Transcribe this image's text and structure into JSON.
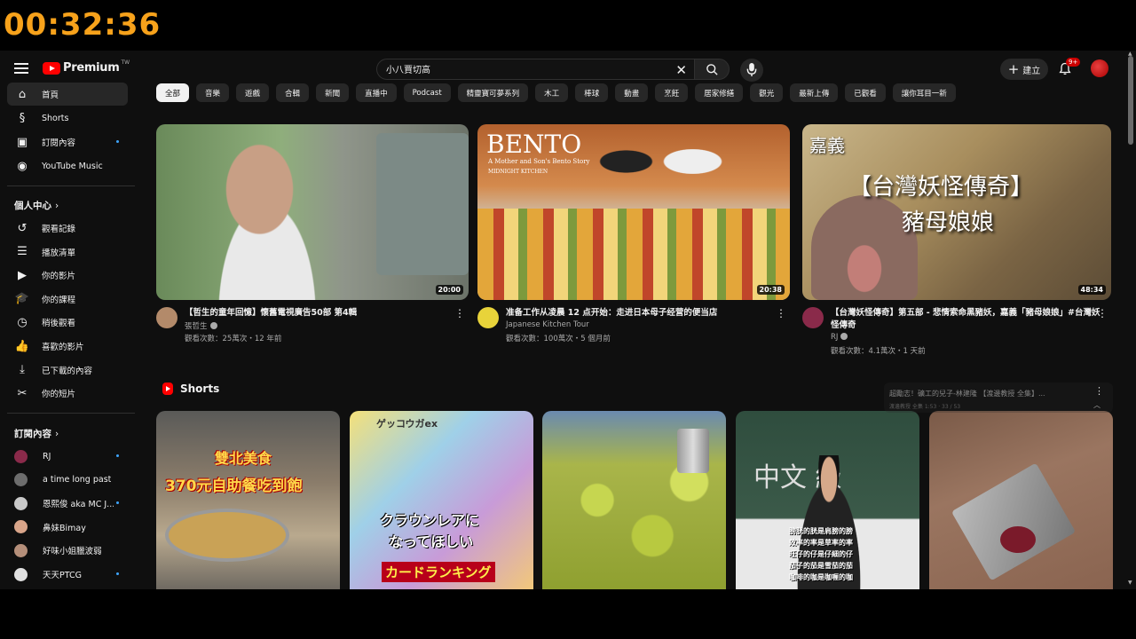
{
  "timer": "00:32:36",
  "header": {
    "brand": "Premium",
    "brand_sup": "TW",
    "search_value": "小八賈切高",
    "create_label": "建立",
    "notification_count": "9+"
  },
  "sidebar": {
    "main": [
      {
        "label": "首頁",
        "icon": "home-icon"
      },
      {
        "label": "Shorts",
        "icon": "shorts-icon"
      },
      {
        "label": "訂閱內容",
        "icon": "subscriptions-icon"
      },
      {
        "label": "YouTube Music",
        "icon": "youtube-music-icon"
      }
    ],
    "you_heading": "個人中心",
    "you": [
      {
        "label": "觀看記錄",
        "icon": "history-icon"
      },
      {
        "label": "播放清單",
        "icon": "playlists-icon"
      },
      {
        "label": "你的影片",
        "icon": "your-videos-icon"
      },
      {
        "label": "你的課程",
        "icon": "courses-icon"
      },
      {
        "label": "稍後觀看",
        "icon": "watch-later-icon"
      },
      {
        "label": "喜歡的影片",
        "icon": "liked-videos-icon"
      },
      {
        "label": "已下載的內容",
        "icon": "downloads-icon"
      },
      {
        "label": "你的短片",
        "icon": "your-clips-icon"
      }
    ],
    "subs_heading": "訂閱內容",
    "subs": [
      {
        "label": "RJ",
        "color": "#8a2a4a"
      },
      {
        "label": "a time long past",
        "color": "#6d6d6d"
      },
      {
        "label": "恩熙俊 aka MC J...",
        "color": "#c9c9c9"
      },
      {
        "label": "鼻妹Bimay",
        "color": "#d9a58a"
      },
      {
        "label": "好味小姐臘波弱",
        "color": "#b58f7a"
      },
      {
        "label": "天天PTCG",
        "color": "#e0e0e0"
      }
    ]
  },
  "chips": [
    "全部",
    "音樂",
    "遊戲",
    "合輯",
    "新聞",
    "直播中",
    "Podcast",
    "精靈寶可夢系列",
    "木工",
    "棒球",
    "動畫",
    "烹飪",
    "居家修繕",
    "觀光",
    "最新上傳",
    "已觀看",
    "讓你耳目一新"
  ],
  "videos": [
    {
      "title": "【哲生的童年回憶】懷舊電視廣告50部 第4輯",
      "channel": "張哲生",
      "stats": "觀看次數：25萬次・12 年前",
      "duration": "20:00",
      "verified": true
    },
    {
      "title": "准备工作从凌晨 12 点开始：走进日本母子经营的便当店",
      "channel": "Japanese Kitchen Tour",
      "stats": "觀看次數：100萬次・5 個月前",
      "duration": "20:38",
      "verified": false,
      "thumb_title": "BENTO",
      "thumb_sub1": "A Mother and Son's Bento Story",
      "thumb_sub2": "MIDNIGHT KITCHEN"
    },
    {
      "title": "【台灣妖怪傳奇】第五部 - 悲情索命黑豬妖，嘉義「豬母娘娘」#台灣妖怪傳奇",
      "channel": "RJ",
      "stats": "觀看次數：4.1萬次・1 天前",
      "duration": "48:34",
      "verified": true,
      "thumb_place": "嘉義",
      "thumb_title": "【台灣妖怪傳奇】",
      "thumb_sub": "豬母娘娘"
    }
  ],
  "shorts": {
    "heading": "Shorts",
    "items": [
      {
        "cap1": "雙北美食",
        "cap2": "370元自助餐吃到飽"
      },
      {
        "cap1": "クラウンレアに",
        "cap2": "なってほしい",
        "cap3": "カードランキング",
        "cap4": "ゲッコウガex"
      },
      {},
      {
        "board": "中文 級",
        "sub1": "膀胱的胱是肩膀的膀",
        "sub2": "效率的率是草率的率",
        "sub3": "旺仔的仔是仔細的仔",
        "sub4": "茄子的茄是雪茄的茄",
        "sub5": "咖啡的咖是咖喱的咖"
      },
      {}
    ]
  },
  "popup": {
    "title": "超勵志！礦工的兒子-林建隆 【渡邊教授 全集】...",
    "sub": "渡邊教授 全集 1:53 · 33 / 53"
  },
  "colors": {
    "accent_red": "#ff0000",
    "timer": "#f7a21b",
    "bg": "#0f0f0f"
  }
}
